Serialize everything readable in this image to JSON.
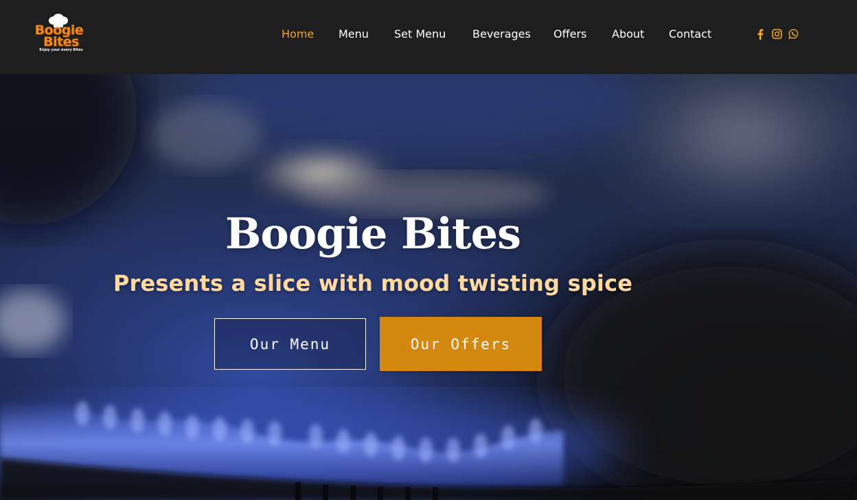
{
  "brand": {
    "name_line1": "Boogie",
    "name_line2": "Bites",
    "tagline": "Enjoy your every Bites",
    "primary_color": "#f28a1c",
    "accent_color": "#d4890e"
  },
  "nav": {
    "items": [
      {
        "label": "Home",
        "active": true
      },
      {
        "label": "Menu",
        "active": false
      },
      {
        "label": "Set Menu",
        "active": false
      },
      {
        "label": "Beverages",
        "active": false
      },
      {
        "label": "Offers",
        "active": false
      },
      {
        "label": "About",
        "active": false
      },
      {
        "label": "Contact",
        "active": false
      }
    ],
    "active_color": "#f5a623"
  },
  "social": {
    "icons": [
      "facebook-icon",
      "instagram-icon",
      "whatsapp-icon"
    ],
    "color": "#f5a623"
  },
  "hero": {
    "title": "Boogie Bites",
    "subtitle": "Presents a slice with mood twisting spice",
    "buttons": {
      "menu_label": "Our Menu",
      "offers_label": "Our Offers"
    }
  }
}
